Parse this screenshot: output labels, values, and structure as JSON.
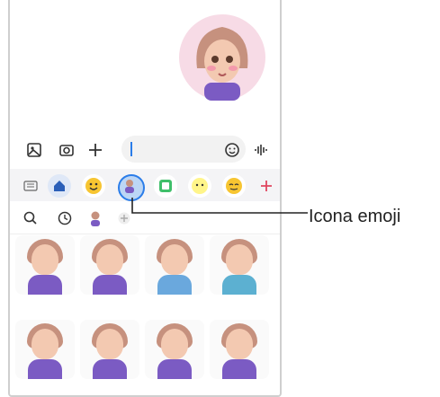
{
  "callout": {
    "label": "Icona emoji"
  },
  "colors": {
    "accent": "#2b7de9",
    "sticker_purple": "#7b5bc3",
    "pink_bg": "#f7dbe6"
  },
  "icons": {
    "input_bar": [
      "gallery-icon",
      "camera-icon",
      "plus-icon",
      "emoji-face-icon",
      "voice-icon"
    ],
    "tray": [
      "keyboard-icon",
      "home-icon",
      "emoji-icon",
      "avatar-emoji-icon",
      "sticker-icon",
      "bitmoji-icon",
      "animated-emoji-icon",
      "add-icon"
    ],
    "tray_secondary": [
      "search-icon",
      "recent-icon",
      "avatar-icon",
      "add-icon"
    ]
  }
}
